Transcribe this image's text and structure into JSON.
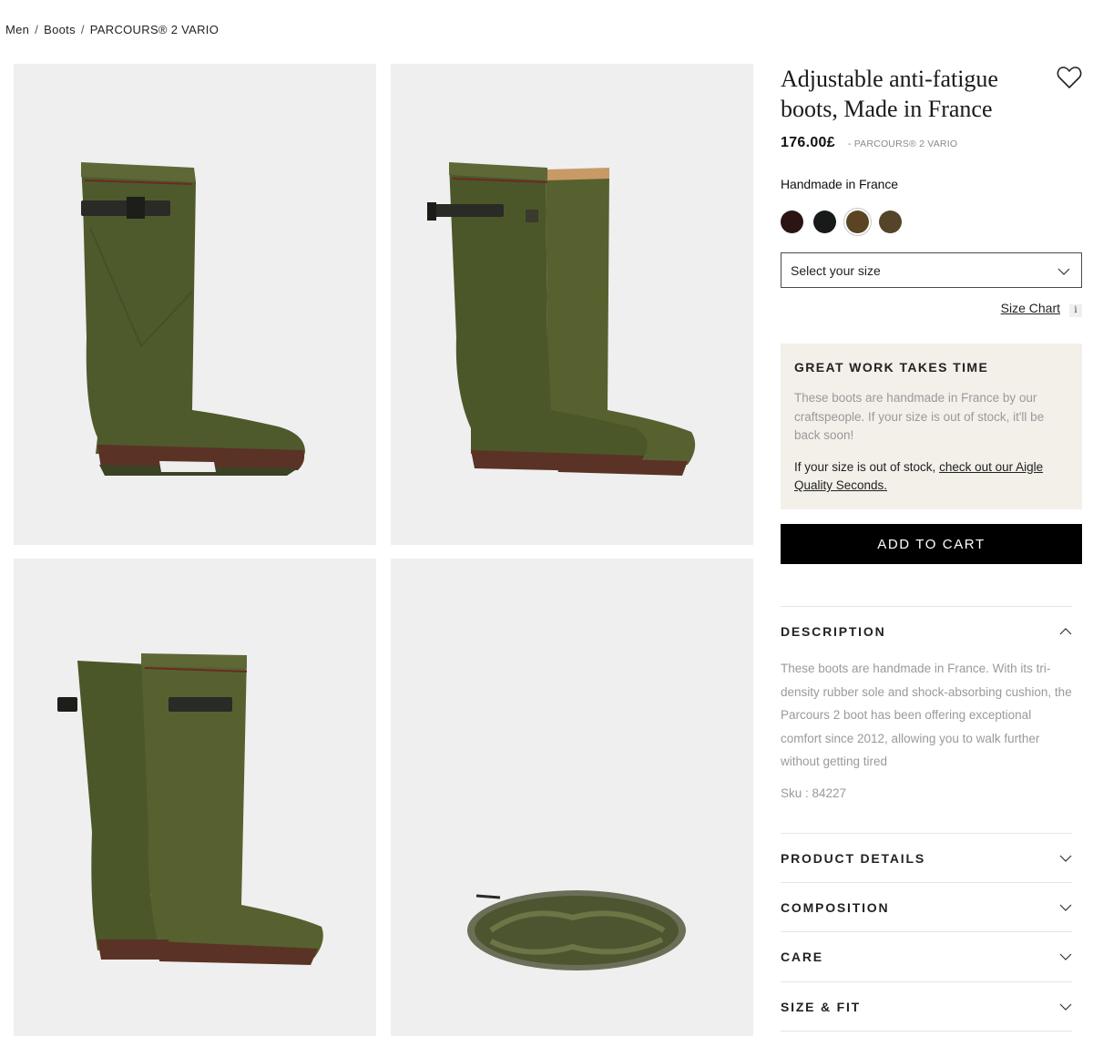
{
  "breadcrumb": {
    "items": [
      "Men",
      "Boots",
      "PARCOURS® 2 VARIO"
    ],
    "separator": "/"
  },
  "product": {
    "title": "Adjustable anti-fatigue boots, Made in France",
    "price": "176.00£",
    "price_ref": "- PARCOURS® 2 VARIO",
    "origin_label": "Handmade in France",
    "swatch_colors": [
      "#2b1412",
      "#181a1a",
      "#5a4424",
      "#55432a"
    ],
    "selected_swatch_index": 2,
    "size_placeholder": "Select your size",
    "size_chart_label": "Size Chart",
    "info_glyph": "i"
  },
  "callout": {
    "title": "GREAT WORK TAKES TIME",
    "body": "These boots are handmade in France by our craftspeople. If your size is out of stock, it'll be back soon!",
    "link_prefix": "If your size is out of stock, ",
    "link_text": "check out our Aigle Quality Seconds."
  },
  "cart": {
    "label": "ADD TO CART"
  },
  "accordion": {
    "description": {
      "label": "DESCRIPTION",
      "body": "These boots are handmade in France. With its tri-density rubber sole and shock-absorbing cushion, the Parcours 2 boot has been offering exceptional comfort since 2012, allowing you to walk further without getting tired",
      "sku": "Sku : 84227",
      "expanded": true
    },
    "product_details": "PRODUCT DETAILS",
    "composition": "COMPOSITION",
    "care": "CARE",
    "size_fit": "SIZE & FIT"
  },
  "icons": {
    "wishlist": "heart-outline-icon",
    "select": "chevron-down-icon",
    "expanded": "chevron-up-icon"
  }
}
